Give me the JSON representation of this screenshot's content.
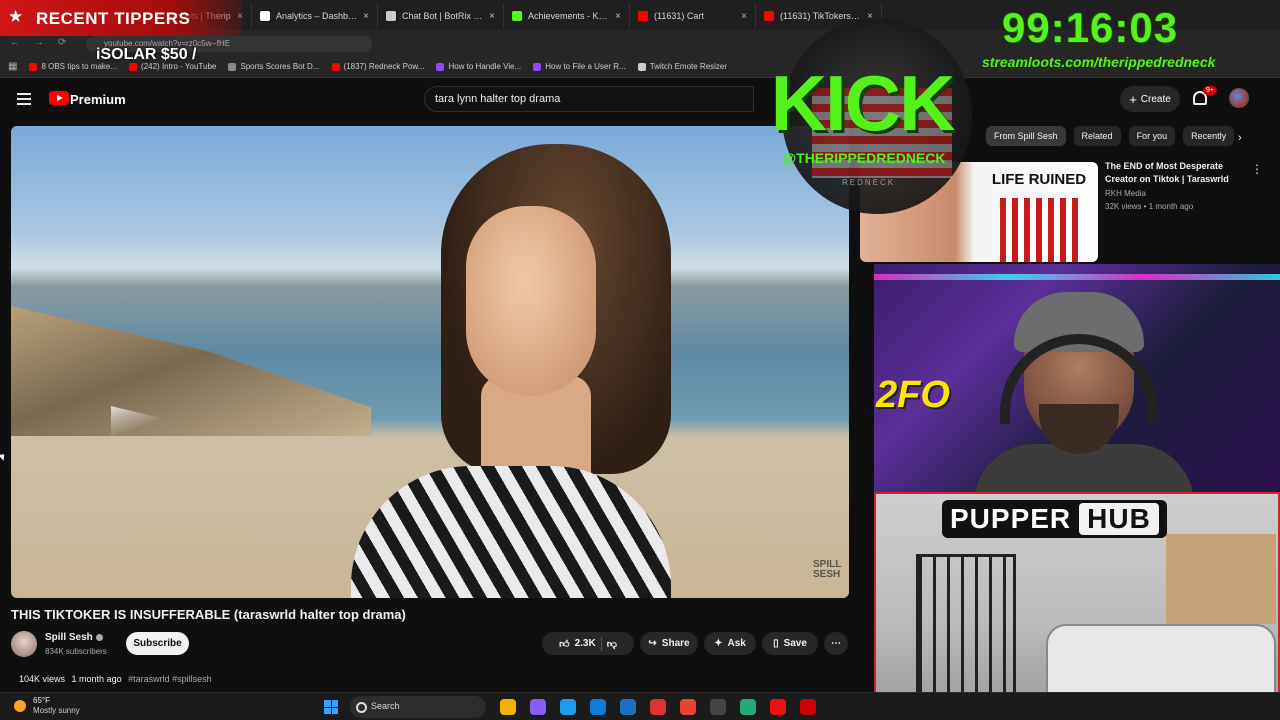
{
  "browser": {
    "tabs": [
      {
        "title": "",
        "color": "#d01616"
      },
      {
        "title": "Streamloots | Therip",
        "color": "#e0245e"
      },
      {
        "title": "Analytics – Dashboard",
        "color": "#ffffff"
      },
      {
        "title": "Chat Bot | BotRix – G",
        "color": "#cccccc"
      },
      {
        "title": "Achievements - Kick D",
        "color": "#53fc18"
      },
      {
        "title": "(11631) Cart",
        "color": "#ff0000"
      },
      {
        "title": "(11631) TikTokers Wh",
        "color": "#ff0000"
      }
    ],
    "url": "youtube.com/watch?v=rz0c5w--fHE",
    "bookmarks": [
      {
        "label": "8 OBS tips to make...",
        "color": "#ff0000"
      },
      {
        "label": "(242) Intro - YouTube",
        "color": "#ff0000"
      },
      {
        "label": "Sports Scores Bot D...",
        "color": "#888888"
      },
      {
        "label": "(1837) Redneck Pow...",
        "color": "#ff0000"
      },
      {
        "label": "How to Handle Vie...",
        "color": "#9146ff"
      },
      {
        "label": "How to File a User R...",
        "color": "#9146ff"
      },
      {
        "label": "Twitch Emote Resizer",
        "color": "#cccccc"
      }
    ]
  },
  "youtube": {
    "brand": "Premium",
    "search_query": "tara lynn halter top drama",
    "create_label": "Create",
    "notification_count": "9+",
    "video": {
      "watermark": "SPILL SESH",
      "title": "THIS TIKTOKER IS INSUFFERABLE (taraswrld halter top drama)",
      "channel": "Spill Sesh",
      "subscribers": "834K subscribers",
      "subscribe_label": "Subscribe",
      "likes": "2.3K",
      "share_label": "Share",
      "ask_label": "Ask",
      "save_label": "Save",
      "views": "104K views",
      "age": "1 month ago",
      "tags": "#taraswrld #spillsesh"
    },
    "chips": [
      "From Spill Sesh",
      "Related",
      "For you",
      "Recently"
    ],
    "recommendation": {
      "thumb_text": "LIFE RUINED",
      "title": "The END of Most Desperate Creator on Tiktok | Taraswrld",
      "channel": "RKH Media",
      "meta": "32K views • 1 month ago"
    }
  },
  "overlay": {
    "tippers_title": "RECENT TIPPERS",
    "tipper_line": "iSOLAR $50 /",
    "timer": "99:16:03",
    "stream_url": "streamloots.com/therippedredneck",
    "kick_word": "KICK",
    "kick_handle": "@THERIPPEDREDNECK",
    "kick_tag": "REDNECK",
    "webcam_sign": "2FO",
    "pupper_word1": "PUPPER",
    "pupper_word2": "HUB"
  },
  "taskbar": {
    "temperature": "65°F",
    "weather": "Mostly sunny",
    "search_label": "Search",
    "apps": [
      "#f0b400",
      "#8a5cf6",
      "#1d9bf0",
      "#0f7dd8",
      "#1d6fbf",
      "#d33",
      "#ea4335",
      "#444",
      "#2a7",
      "#e11",
      "#c00"
    ]
  }
}
